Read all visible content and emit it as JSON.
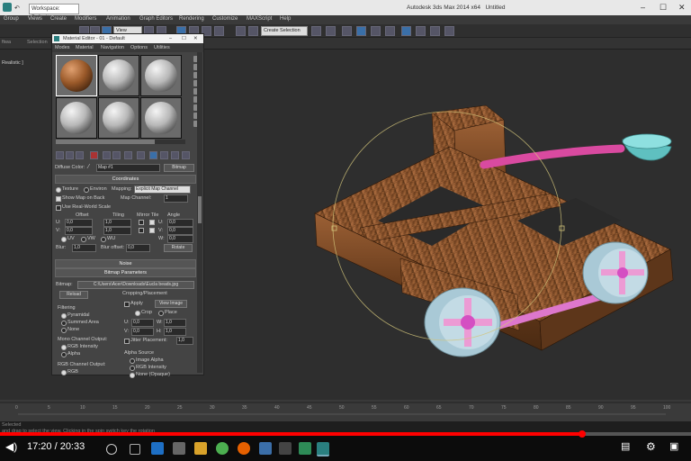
{
  "titlebar": {
    "workspace": "Workspace: Default",
    "app_title": "Autodesk 3ds Max  2014 x64",
    "file": "Untitled"
  },
  "menu": [
    "Group",
    "Views",
    "Create",
    "Modifiers",
    "Animation",
    "Graph Editors",
    "Rendering",
    "Customize",
    "MAXScript",
    "Help"
  ],
  "toolbar": {
    "view_dropdown": "View",
    "selection_set": "Create Selection Se"
  },
  "ribbon": {
    "left_label": "ftwa",
    "selection": "Selection"
  },
  "viewport": {
    "label": "Realistic ]"
  },
  "material_editor": {
    "title": "Material Editor - 01 - Default",
    "menu": [
      "Modes",
      "Material",
      "Navigation",
      "Options",
      "Utilities"
    ],
    "diffuse_color_label": "Diffuse Color:",
    "map_name": "Map #1",
    "map_type": "Bitmap",
    "coordinates_rollout": "Coordinates",
    "texture_label": "Texture",
    "environ_label": "Environ",
    "mapping_label": "Mapping:",
    "mapping_value": "Explicit Map Channel",
    "show_map_label": "Show Map on Back",
    "map_channel_label": "Map Channel:",
    "map_channel_value": "1",
    "real_world_label": "Use Real-World Scale",
    "col_offset": "Offset",
    "col_tiling": "Tiling",
    "col_mirror": "Mirror Tile",
    "col_angle": "Angle",
    "u_label": "U:",
    "v_label": "V:",
    "w_label": "W:",
    "u_offset": "0,0",
    "v_offset": "0,0",
    "u_tiling": "1,0",
    "v_tiling": "1,0",
    "u_angle": "0,0",
    "v_angle": "0,0",
    "w_angle": "0,0",
    "uv_label": "UV",
    "vw_label": "VW",
    "wu_label": "WU",
    "blur_label": "Blur:",
    "blur_value": "1,0",
    "blur_offset_label": "Blur offset:",
    "blur_offset_value": "0,0",
    "rotate_button": "Rotate",
    "noise_rollout": "Noise",
    "bitmap_params_rollout": "Bitmap Parameters",
    "bitmap_label": "Bitmap:",
    "bitmap_path": "C:\\Users\\Acer\\Downloads\\Eucla beads.jpg",
    "reload_button": "Reload",
    "cropping_label": "Cropping/Placement",
    "apply_label": "Apply",
    "view_image_button": "View Image",
    "crop_label": "Crop",
    "place_label": "Place",
    "filtering_label": "Filtering",
    "pyramidal_label": "Pyramidal",
    "summed_label": "Summed Area",
    "none_label": "None",
    "u_crop": "0,0",
    "v_crop": "0,0",
    "w_crop_label": "W:",
    "h_crop_label": "H:",
    "w_crop": "1,0",
    "h_crop": "1,0",
    "jitter_label": "Jitter Placement:",
    "jitter_value": "1,0",
    "mono_label": "Mono Channel Output:",
    "rgb_intensity_label": "RGB Intensity",
    "alpha_label": "Alpha",
    "alpha_source_label": "Alpha Source",
    "image_alpha_label": "Image Alpha",
    "rgb_intensity2_label": "RGB Intensity",
    "none_opaque_label": "None (Opaque)",
    "rgb_output_label": "RGB Channel Output:",
    "rgb_label": "RGB"
  },
  "timeline": {
    "ticks": [
      "0",
      "5",
      "10",
      "15",
      "20",
      "25",
      "30",
      "35",
      "40",
      "45",
      "50",
      "55",
      "60",
      "65",
      "70",
      "75",
      "80",
      "85",
      "90",
      "95",
      "100"
    ]
  },
  "statusbar": {
    "selected": "Selected",
    "prompt": "and drag to select the view.  Clicking in the spin  switch key the rotation"
  },
  "player": {
    "time": "17:20 / 20:33",
    "progress_fraction": 0.843
  }
}
